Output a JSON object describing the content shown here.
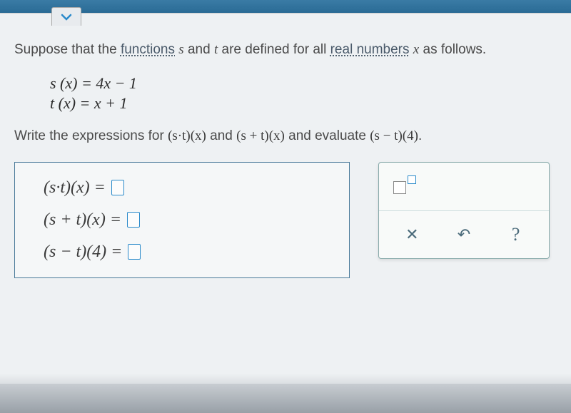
{
  "problem": {
    "intro_pre": "Suppose that the ",
    "intro_link1": "functions",
    "intro_mid1": " ",
    "intro_var_s": "s",
    "intro_mid2": " and ",
    "intro_var_t": "t",
    "intro_mid3": " are defined for all ",
    "intro_link2": "real numbers",
    "intro_mid4": " ",
    "intro_var_x": "x",
    "intro_post": " as follows."
  },
  "definitions": {
    "eq1": "s (x) = 4x − 1",
    "eq2": "t (x) = x + 1"
  },
  "instruction": {
    "pre": "Write the expressions for ",
    "expr1": "(s·t)(x)",
    "mid1": " and ",
    "expr2": "(s + t)(x)",
    "mid2": " and evaluate ",
    "expr3": "(s − t)(4)",
    "post": "."
  },
  "answers": {
    "row1_label": "(s·t)(x) = ",
    "row2_label": "(s + t)(x) = ",
    "row3_label": "(s − t)(4) = "
  },
  "tools": {
    "clear": "✕",
    "reset": "↶",
    "help": "?"
  }
}
